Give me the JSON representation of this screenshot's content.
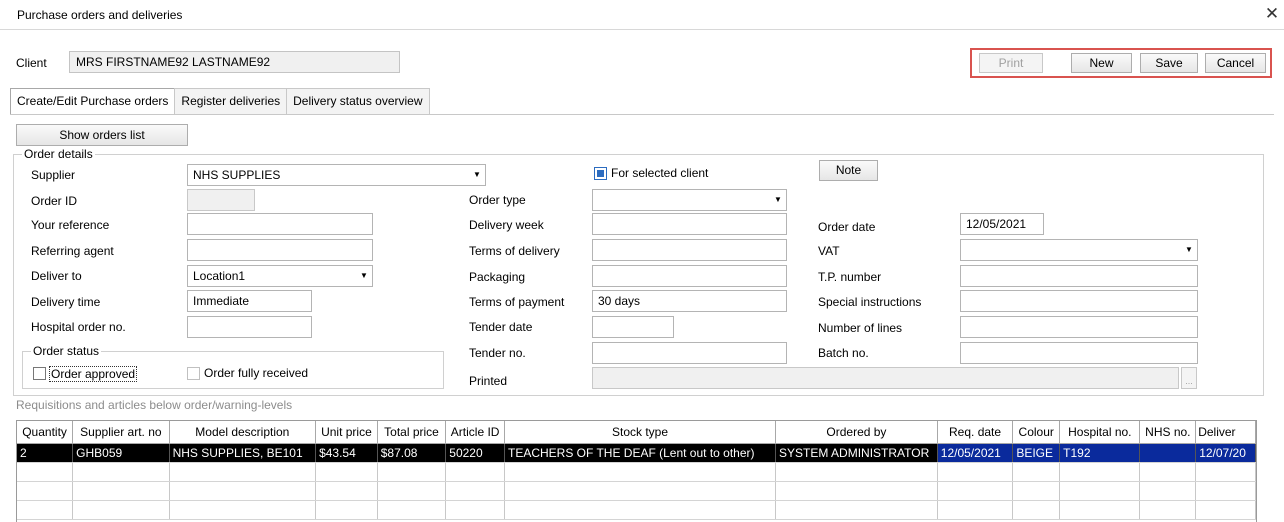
{
  "window": {
    "title": "Purchase orders and deliveries",
    "close_glyph": "✕"
  },
  "client": {
    "label": "Client",
    "value": "MRS FIRSTNAME92 LASTNAME92"
  },
  "toolbar": {
    "print": "Print",
    "new": "New",
    "save": "Save",
    "cancel": "Cancel"
  },
  "tabs": [
    "Create/Edit Purchase orders",
    "Register deliveries",
    "Delivery status overview"
  ],
  "show_orders_label": "Show orders list",
  "order_details": {
    "legend": "Order details",
    "supplier": {
      "label": "Supplier",
      "value": "NHS SUPPLIES"
    },
    "order_id": {
      "label": "Order ID",
      "value": ""
    },
    "your_reference": {
      "label": "Your reference",
      "value": ""
    },
    "referring_agent": {
      "label": "Referring agent",
      "value": ""
    },
    "deliver_to": {
      "label": "Deliver to",
      "value": "Location1"
    },
    "delivery_time": {
      "label": "Delivery time",
      "value": "Immediate"
    },
    "hospital_order_no": {
      "label": "Hospital order no.",
      "value": ""
    },
    "for_selected_client": "For selected client",
    "note_button": "Note",
    "order_type": {
      "label": "Order type",
      "value": ""
    },
    "delivery_week": {
      "label": "Delivery week",
      "value": ""
    },
    "terms_of_delivery": {
      "label": "Terms of delivery",
      "value": ""
    },
    "packaging": {
      "label": "Packaging",
      "value": ""
    },
    "terms_of_payment": {
      "label": "Terms of payment",
      "value": "30 days"
    },
    "tender_date": {
      "label": "Tender date",
      "value": ""
    },
    "tender_no": {
      "label": "Tender no.",
      "value": ""
    },
    "printed": {
      "label": "Printed",
      "value": "",
      "button": "..."
    },
    "order_date": {
      "label": "Order date",
      "value": "12/05/2021"
    },
    "vat": {
      "label": "VAT",
      "value": ""
    },
    "tp_number": {
      "label": "T.P. number",
      "value": ""
    },
    "special_instructions": {
      "label": "Special instructions",
      "value": ""
    },
    "number_of_lines": {
      "label": "Number of lines",
      "value": ""
    },
    "batch_no": {
      "label": "Batch no.",
      "value": ""
    }
  },
  "order_status": {
    "legend": "Order status",
    "approved": {
      "label": "Order approved",
      "checked": false
    },
    "fully_received": {
      "label": "Order fully received",
      "checked": false
    }
  },
  "requisitions_caption": "Requisitions and articles below order/warning-levels",
  "grid": {
    "columns": [
      "Quantity",
      "Supplier art. no",
      "Model description",
      "Unit price",
      "Total price",
      "Article ID",
      "Stock type",
      "Ordered by",
      "Req. date",
      "Colour",
      "Hospital no.",
      "NHS no.",
      "Deliver"
    ],
    "rows": [
      [
        "2",
        "GHB059",
        "NHS SUPPLIES, BE101",
        "$43.54",
        "$87.08",
        "50220",
        "TEACHERS OF THE DEAF (Lent out to other)",
        "SYSTEM ADMINISTRATOR",
        "12/05/2021",
        "BEIGE",
        "T192",
        "",
        "12/07/20"
      ]
    ]
  },
  "colors": {
    "accent_frame": "#d9534f",
    "selected_row": "#000000",
    "selected_blue": "#0a2a9c"
  }
}
